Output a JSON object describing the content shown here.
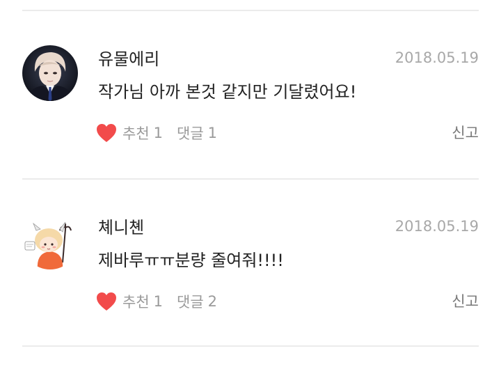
{
  "comments": [
    {
      "author": "유물에리",
      "date": "2018.05.19",
      "text": "작가님 아까 본것 같지만 기달렸어요!",
      "like_label": "추천",
      "like_count": "1",
      "reply_label": "댓글",
      "reply_count": "1",
      "report_label": "신고"
    },
    {
      "author": "쳬니쳰",
      "date": "2018.05.19",
      "text": "제바루ㅠㅠ분량 줄여줘!!!!",
      "like_label": "추천",
      "like_count": "1",
      "reply_label": "댓글",
      "reply_count": "2",
      "report_label": "신고"
    }
  ],
  "colors": {
    "heart": "#f24b4b",
    "divider": "#ebebeb",
    "meta_text": "#9a9a9a",
    "date_text": "#a8a8a8"
  },
  "icons": {
    "like": "heart-icon"
  }
}
